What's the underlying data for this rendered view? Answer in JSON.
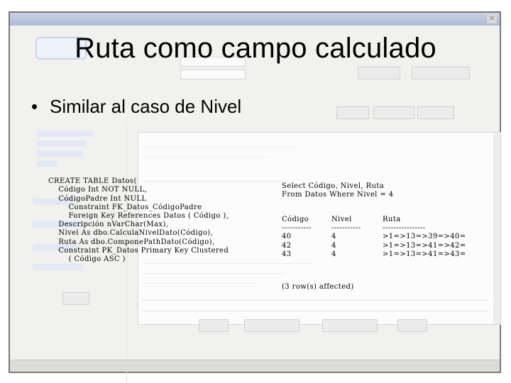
{
  "slide": {
    "title": "Ruta como campo calculado",
    "bullet": "Similar al caso de Nivel"
  },
  "code": [
    "CREATE TABLE Datos(",
    "    Código Int NOT NULL,",
    "    CódigoPadre Int NULL",
    "        Constraint FK_Datos_CódigoPadre",
    "        Foreign Key References Datos ( Código ),",
    "    Descripción nVarChar(Max),",
    "    Nivel As dbo.CalculaNivelDato(Código),",
    "    Ruta As dbo.ComponePathDato(Código),",
    "    Constraint PK_Datos Primary Key Clustered",
    "        ( Código ASC )"
  ],
  "query": [
    "Select Código, Nivel, Ruta",
    "From Datos Where Nivel = 4"
  ],
  "result": {
    "headers": [
      "Código",
      "Nivel",
      "Ruta"
    ],
    "separators": [
      "-----------",
      "-----------",
      "----------------"
    ],
    "rows": [
      [
        "40",
        "4",
        ">1=>13=>39=>40="
      ],
      [
        "42",
        "4",
        ">1=>13=>41=>42="
      ],
      [
        "43",
        "4",
        ">1=>13=>41=>43="
      ]
    ],
    "footer": "(3 row(s) affected)"
  }
}
